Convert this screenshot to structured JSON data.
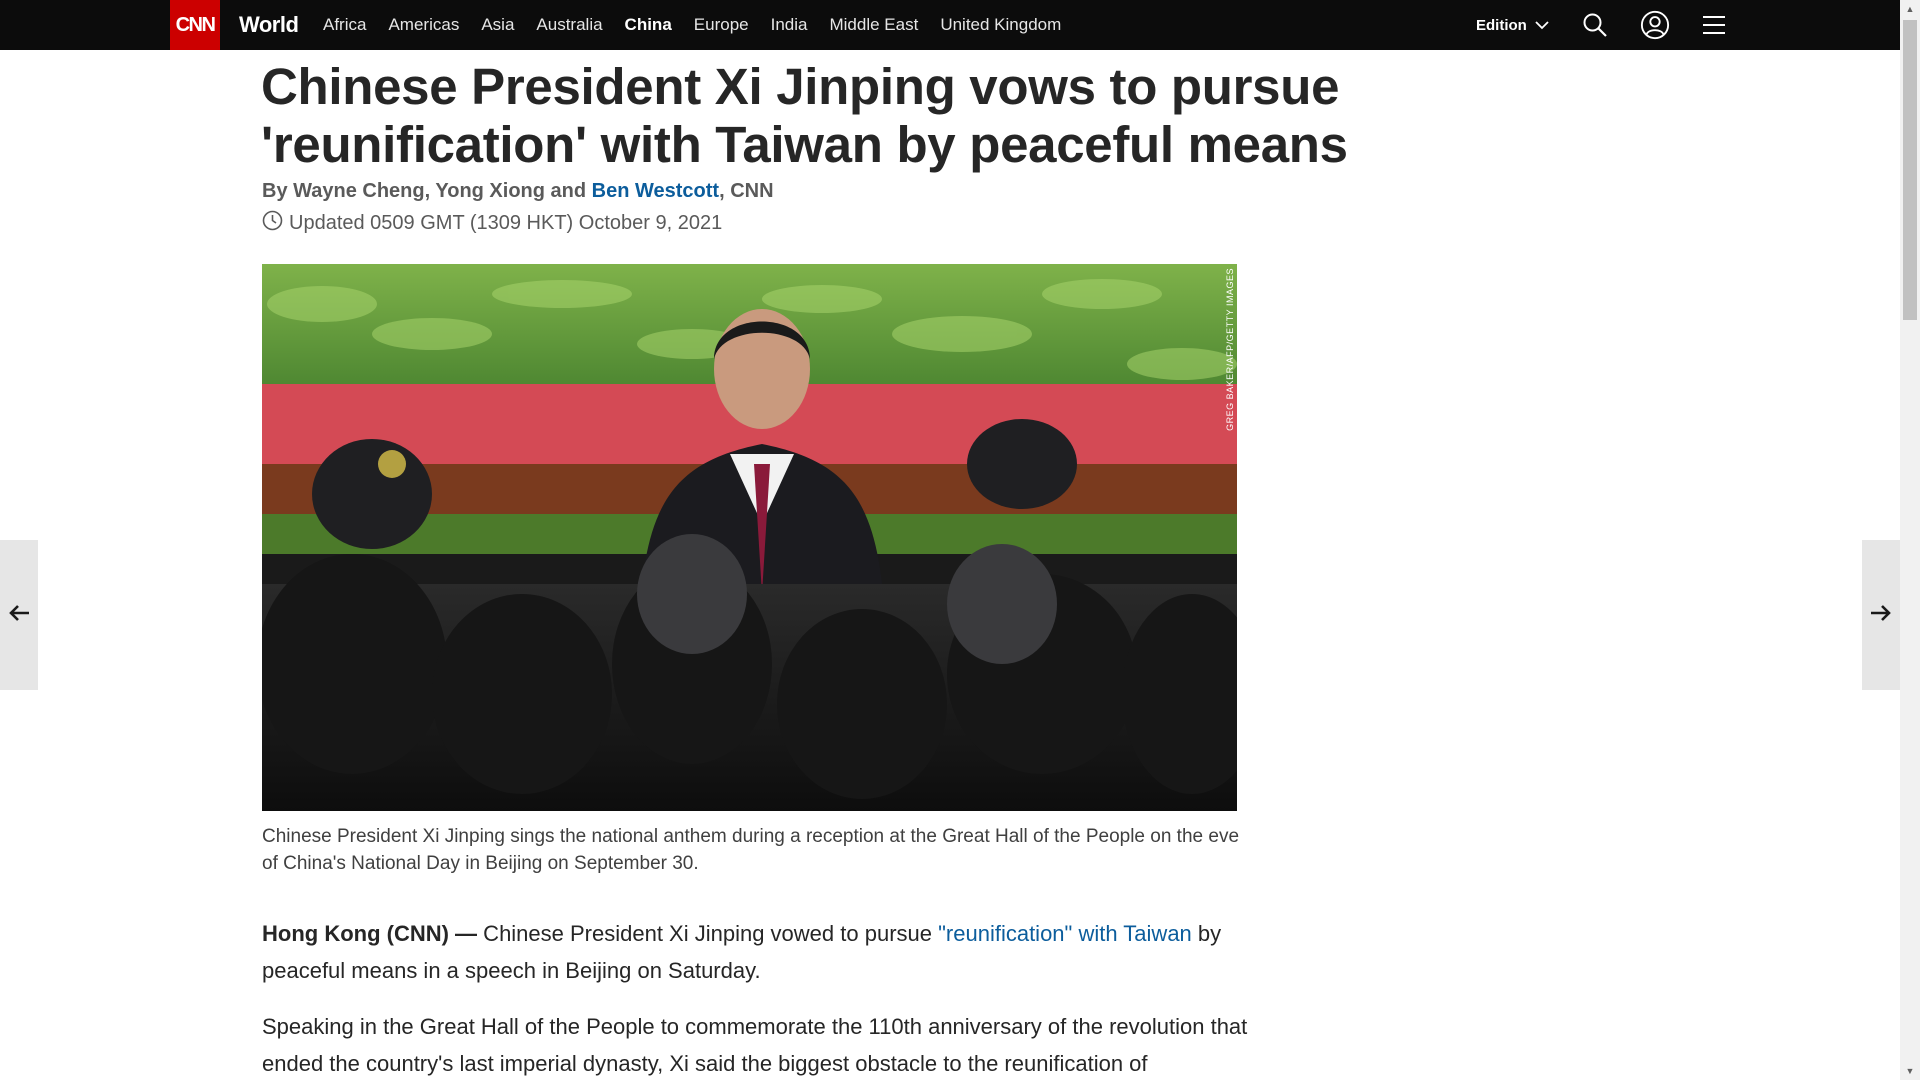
{
  "nav": {
    "logo": "CNN",
    "section_title": "World",
    "links": [
      "Africa",
      "Americas",
      "Asia",
      "Australia",
      "China",
      "Europe",
      "India",
      "Middle East",
      "United Kingdom"
    ],
    "active_link": "China",
    "edition_label": "Edition"
  },
  "article": {
    "headline": "Chinese President Xi Jinping vows to pursue 'reunification' with Taiwan by peaceful means",
    "byline_prefix": "By Wayne Cheng, Yong Xiong and ",
    "byline_author_link": "Ben Westcott",
    "byline_suffix": ", CNN",
    "timestamp": "Updated 0509 GMT (1309 HKT) October 9, 2021",
    "photo_credit": "GREG BAKER/AFP/GETTY IMAGES",
    "caption": "Chinese President Xi Jinping sings the national anthem during a reception at the Great Hall of the People on the eve of China's National Day in Beijing on September 30.",
    "para1_dateline": "Hong Kong (CNN) —",
    "para1_text_a": " Chinese President Xi Jinping vowed to pursue ",
    "para1_link": "\"reunification\" with Taiwan",
    "para1_text_b": " by peaceful means in a speech in Beijing on Saturday.",
    "para2": "Speaking in the Great Hall of the People to commemorate the 110th anniversary of the revolution that ended the country's last imperial dynasty, Xi said the biggest obstacle to the reunification of"
  },
  "colors": {
    "nav_bg": "#0c0c0c",
    "brand_red": "#cc0000",
    "link_blue": "#0c5d9c",
    "text": "#262626"
  },
  "icons": [
    "chevron-down-icon",
    "search-icon",
    "account-icon",
    "menu-icon",
    "clock-icon",
    "arrow-left-icon",
    "arrow-right-icon"
  ]
}
